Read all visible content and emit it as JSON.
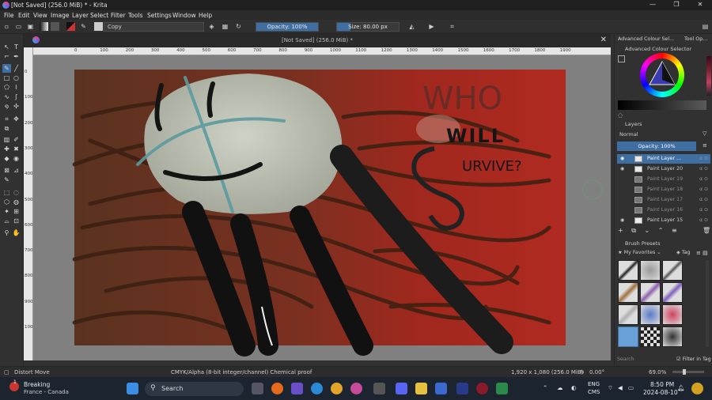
{
  "window": {
    "title": "[Not Saved]  (256.0 MiB) * - Krita",
    "controls": [
      "—",
      "❐",
      "✕"
    ]
  },
  "menu": [
    "File",
    "Edit",
    "View",
    "Image",
    "Layer",
    "Select",
    "Filter",
    "Tools",
    "Settings",
    "Window",
    "Help"
  ],
  "toolbar": {
    "blend_mode": "Copy",
    "opacity_label": "Opacity: 100%",
    "opacity_value": 1.0,
    "size_label": "Size: 80.00 px",
    "size_fraction": 0.22
  },
  "document": {
    "tab_title": "[Not Saved]  (256.0 MiB) *",
    "close": "✕",
    "ruler_marks": [
      "0",
      "100",
      "200",
      "300",
      "400",
      "500",
      "600",
      "700",
      "800",
      "900",
      "1000",
      "1100",
      "1200",
      "1300",
      "1400",
      "1500",
      "1600",
      "1700",
      "1800",
      "1900"
    ],
    "vruler_marks": [
      "0",
      "100",
      "200",
      "300",
      "400",
      "500",
      "600",
      "700",
      "800",
      "900",
      "1000"
    ]
  },
  "artwork": {
    "bg_color": "#a3291f",
    "line1": "WHO",
    "line2": "WILL",
    "line3": "URVIVE?"
  },
  "dock": {
    "tabs": [
      "Advanced Colour Sel...",
      "Tool Op..."
    ],
    "colour_panel_title": "Advanced Colour Selector",
    "layers_title": "Layers",
    "blend": "Normal",
    "opacity": "Opacity:  100%",
    "layers": [
      {
        "name": "Paint Layer ...",
        "selected": true
      },
      {
        "name": "Paint Layer 20",
        "selected": false
      },
      {
        "name": "Paint Layer 19",
        "selected": false
      },
      {
        "name": "Paint Layer 18",
        "selected": false
      },
      {
        "name": "Paint Layer 17",
        "selected": false
      },
      {
        "name": "Paint Layer 16",
        "selected": false
      },
      {
        "name": "Paint Layer 15",
        "selected": false
      }
    ],
    "brush_title": "Brush Presets",
    "favorites": "My Favorites",
    "tag": "Tag",
    "search_placeholder": "Search",
    "filter_in_tag": "Filter in Tag"
  },
  "status": {
    "tool": "Distort Move",
    "color_space": "CMYK/Alpha (8-bit integer/channel)  Chemical proof",
    "dimensions": "1,920 x 1,080 (256.0 MiB)",
    "rotation": "0.00°",
    "zoom": "69.0%"
  },
  "taskbar": {
    "news_title": "Breaking",
    "news_sub": "France - Canada",
    "search": "Search",
    "lang1": "ENG",
    "lang2": "CMS",
    "time": "8:50 PM",
    "date": "2024-08-10",
    "badge": "1"
  }
}
